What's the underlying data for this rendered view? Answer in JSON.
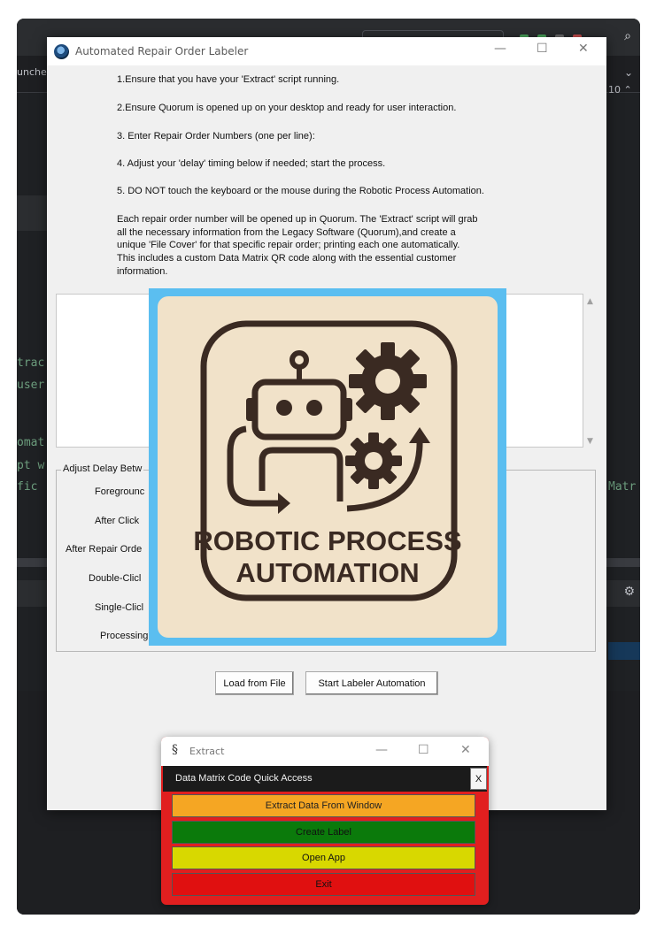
{
  "ide": {
    "tab_label": "uncher",
    "line_number": "10",
    "code_fragments": [
      "trac",
      "user",
      "omat",
      "pt w",
      "fic"
    ],
    "code_right": "Matr"
  },
  "window": {
    "title": "Automated Repair Order Labeler",
    "minimize": "—",
    "maximize": "☐",
    "close": "✕"
  },
  "instructions": [
    "1.Ensure that you have your 'Extract' script running.",
    "2.Ensure Quorum is opened up on your desktop and ready for user interaction.",
    "3. Enter Repair Order Numbers (one per line):",
    "4. Adjust your 'delay' timing below if needed; start the process.",
    "5. DO NOT touch the keyboard or the mouse during the Robotic Process Automation."
  ],
  "description": "Each repair order number will be opened up in Quorum. The 'Extract' script will grab\nall the necessary information from the Legacy Software (Quorum),and create a\nunique 'File Cover' for that specific repair order; printing each one automatically.\nThis includes a custom Data Matrix QR code along with the essential customer\ninformation.",
  "repair_order_input": {
    "value": ""
  },
  "delay_section": {
    "legend": "Adjust Delay Betw",
    "labels": [
      "Foregrounc",
      "After Click",
      "After Repair Orde",
      "Double-Clicl",
      "Single-Clicl",
      "Processing"
    ]
  },
  "buttons": {
    "load": "Load from File",
    "start": "Start Labeler Automation"
  },
  "overlay": {
    "line1": "ROBOTIC PROCESS",
    "line2": "AUTOMATION"
  },
  "extract": {
    "icon": "§",
    "title": "Extract",
    "minimize": "—",
    "maximize": "☐",
    "close": "✕",
    "header": "Data Matrix Code Quick Access",
    "header_close": "X",
    "buttons": [
      {
        "label": "Extract Data From Window",
        "bg": "#f5a623",
        "fg": "#222222"
      },
      {
        "label": "Create Label",
        "bg": "#0b7a0b",
        "fg": "#111111"
      },
      {
        "label": "Open App",
        "bg": "#d8d800",
        "fg": "#111111"
      },
      {
        "label": "Exit",
        "bg": "#e01010",
        "fg": "#111111"
      }
    ]
  },
  "colors": {
    "overlay_border": "#5bbef0",
    "overlay_card": "#f1e2c9",
    "overlay_ink": "#3a2a22",
    "extract_frame": "#e11f1f"
  }
}
